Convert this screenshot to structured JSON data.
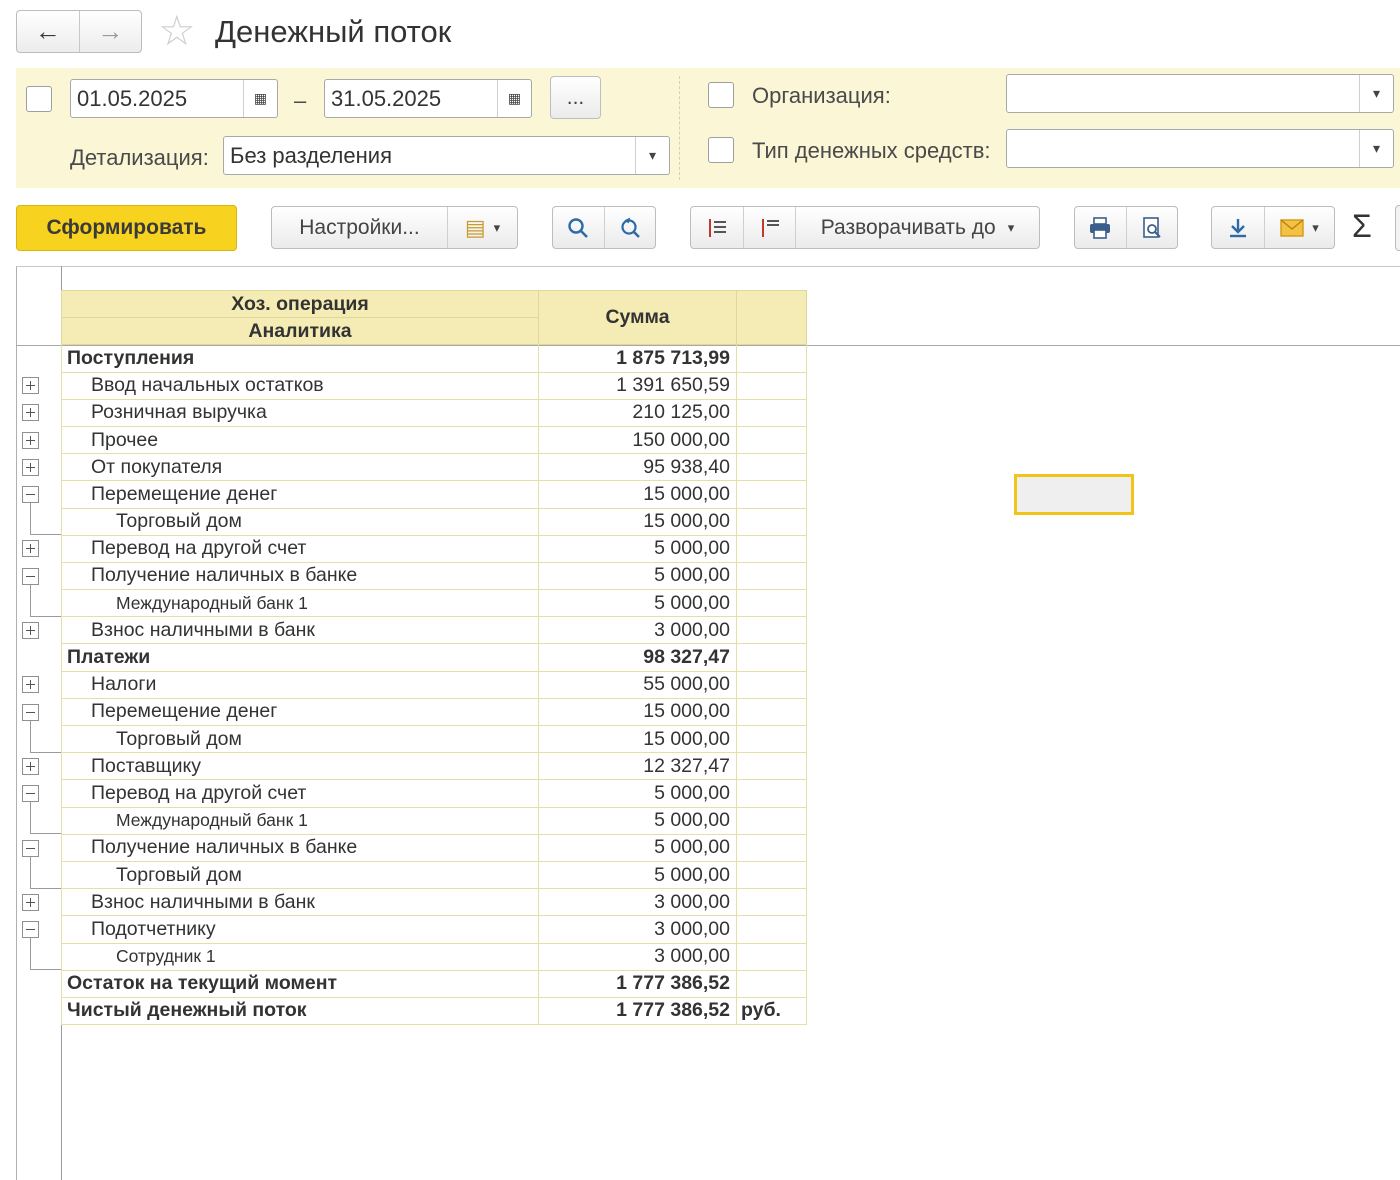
{
  "window": {
    "title": "Денежный поток"
  },
  "filters": {
    "date_from": "01.05.2025",
    "date_to": "31.05.2025",
    "dash": "–",
    "more_button": "...",
    "detail_label": "Детализация:",
    "detail_value": "Без разделения",
    "org_label": "Организация:",
    "org_value": "",
    "money_type_label": "Тип денежных средств:",
    "money_type_value": ""
  },
  "toolbar": {
    "generate": "Сформировать",
    "settings": "Настройки...",
    "expand_to": "Разворачивать до",
    "sigma": "Σ"
  },
  "report": {
    "headers": {
      "col1_top": "Хоз. операция",
      "col1_bottom": "Аналитика",
      "col2": "Сумма"
    },
    "rows": [
      {
        "label": "Поступления",
        "amount": "1 875 713,99",
        "level": 0
      },
      {
        "label": "Ввод начальных остатков",
        "amount": "1 391 650,59",
        "level": 1,
        "toggle": "plus"
      },
      {
        "label": "Розничная выручка",
        "amount": "210 125,00",
        "level": 1,
        "toggle": "plus"
      },
      {
        "label": "Прочее",
        "amount": "150 000,00",
        "level": 1,
        "toggle": "plus"
      },
      {
        "label": "От покупателя",
        "amount": "95 938,40",
        "level": 1,
        "toggle": "plus"
      },
      {
        "label": "Перемещение денег",
        "amount": "15 000,00",
        "level": 1,
        "toggle": "minus"
      },
      {
        "label": "Торговый дом",
        "amount": "15 000,00",
        "level": 2
      },
      {
        "label": "Перевод на другой счет",
        "amount": "5 000,00",
        "level": 1,
        "toggle": "plus"
      },
      {
        "label": "Получение наличных в банке",
        "amount": "5 000,00",
        "level": 1,
        "toggle": "minus"
      },
      {
        "label": "Международный банк 1",
        "amount": "5 000,00",
        "level": 2,
        "small": true
      },
      {
        "label": "Взнос наличными в банк",
        "amount": "3 000,00",
        "level": 1,
        "toggle": "plus"
      },
      {
        "label": "Платежи",
        "amount": "98 327,47",
        "level": 0
      },
      {
        "label": "Налоги",
        "amount": "55 000,00",
        "level": 1,
        "toggle": "plus"
      },
      {
        "label": "Перемещение денег",
        "amount": "15 000,00",
        "level": 1,
        "toggle": "minus"
      },
      {
        "label": "Торговый дом",
        "amount": "15 000,00",
        "level": 2
      },
      {
        "label": "Поставщику",
        "amount": "12 327,47",
        "level": 1,
        "toggle": "plus"
      },
      {
        "label": "Перевод на другой счет",
        "amount": "5 000,00",
        "level": 1,
        "toggle": "minus"
      },
      {
        "label": "Международный банк 1",
        "amount": "5 000,00",
        "level": 2,
        "small": true
      },
      {
        "label": "Получение наличных в банке",
        "amount": "5 000,00",
        "level": 1,
        "toggle": "minus"
      },
      {
        "label": "Торговый дом",
        "amount": "5 000,00",
        "level": 2
      },
      {
        "label": "Взнос наличными в банк",
        "amount": "3 000,00",
        "level": 1,
        "toggle": "plus"
      },
      {
        "label": "Подотчетнику",
        "amount": "3 000,00",
        "level": 1,
        "toggle": "minus"
      },
      {
        "label": "Сотрудник 1",
        "amount": "3 000,00",
        "level": 2,
        "small": true
      },
      {
        "label": "Остаток на текущий момент",
        "amount": "1 777 386,52",
        "level": 0,
        "bold": true
      },
      {
        "label": "Чистый денежный поток",
        "amount": "1 777 386,52",
        "level": 0,
        "bold": true,
        "unit": "руб."
      }
    ]
  },
  "colors": {
    "accent": "#f7d31f",
    "filter_bg": "#faf6d6",
    "header_bg": "#f4ecb4",
    "grid": "#e3dfa6"
  }
}
